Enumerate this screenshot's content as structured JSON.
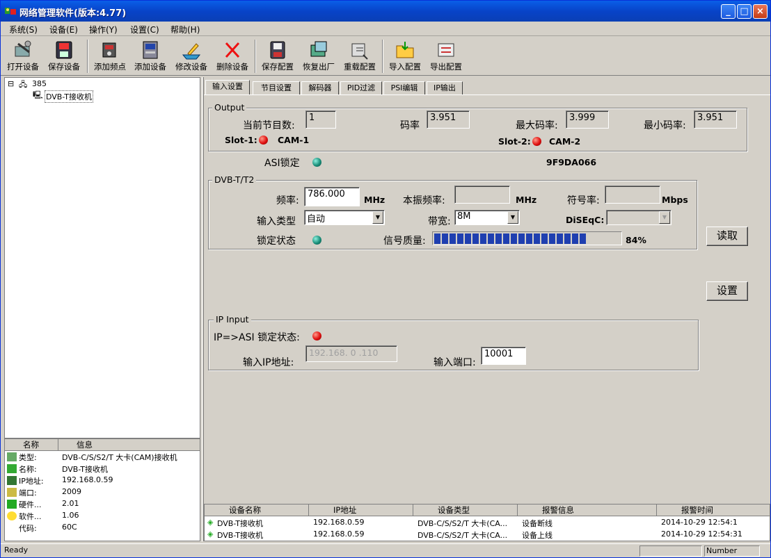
{
  "window": {
    "title": "网络管理软件(版本:4.77)"
  },
  "menu": [
    "系统(S)",
    "设备(E)",
    "操作(Y)",
    "设置(C)",
    "帮助(H)"
  ],
  "toolbar": [
    "打开设备",
    "保存设备",
    "添加频点",
    "添加设备",
    "修改设备",
    "删除设备",
    "保存配置",
    "恢复出厂",
    "重载配置",
    "导入配置",
    "导出配置"
  ],
  "tree": {
    "root": "385",
    "child": "DVB-T接收机"
  },
  "info": {
    "headers": [
      "名称",
      "信息"
    ],
    "rows": [
      {
        "k": "类型:",
        "v": "DVB-C/S/S2/T 大卡(CAM)接收机"
      },
      {
        "k": "名称:",
        "v": "DVB-T接收机"
      },
      {
        "k": "IP地址:",
        "v": "192.168.0.59"
      },
      {
        "k": "端口:",
        "v": "2009"
      },
      {
        "k": "硬件...",
        "v": "2.01"
      },
      {
        "k": "软件...",
        "v": "1.06"
      },
      {
        "k": "代码:",
        "v": "60C"
      }
    ]
  },
  "tabs": [
    "输入设置",
    "节目设置",
    "解码器",
    "PID过滤",
    "PSI编辑",
    "IP输出"
  ],
  "output": {
    "title": "Output",
    "prog_label": "当前节目数:",
    "prog_value": "1",
    "rate_label": "码率",
    "rate_value": "3.951",
    "max_label": "最大码率:",
    "max_value": "3.999",
    "min_label": "最小码率:",
    "min_value": "3.951",
    "slot1_label": "Slot-1:",
    "slot1_cam": "CAM-1",
    "slot2_label": "Slot-2:",
    "slot2_cam": "CAM-2"
  },
  "asi": {
    "label": "ASI锁定",
    "code": "9F9DA066"
  },
  "dvbt": {
    "title": "DVB-T/T2",
    "freq_label": "频率:",
    "freq_value": "786.000",
    "freq_unit": "MHz",
    "lo_label": "本振频率:",
    "lo_value": "",
    "lo_unit": "MHz",
    "sym_label": "符号率:",
    "sym_value": "",
    "sym_unit": "Mbps",
    "type_label": "输入类型",
    "type_value": "自动",
    "bw_label": "带宽:",
    "bw_value": "8M",
    "diseqc_label": "DiSEqC:",
    "diseqc_value": "",
    "lock_label": "锁定状态",
    "quality_label": "信号质量:",
    "quality_percent": 84,
    "quality_text": "84%"
  },
  "buttons": {
    "read": "读取",
    "set": "设置"
  },
  "ip_input": {
    "title": "IP Input",
    "lock_label": "IP=>ASI 锁定状态:",
    "ip_label": "输入IP地址:",
    "ip_value": "192.168. 0 .110",
    "port_label": "输入端口:",
    "port_value": "10001"
  },
  "alarms": {
    "headers": [
      "设备名称",
      "IP地址",
      "设备类型",
      "报警信息",
      "报警时间"
    ],
    "rows": [
      [
        "DVB-T接收机",
        "192.168.0.59",
        "DVB-C/S/S2/T 大卡(CA...",
        "设备断线",
        "2014-10-29 12:54:1"
      ],
      [
        "DVB-T接收机",
        "192.168.0.59",
        "DVB-C/S/S2/T 大卡(CA...",
        "设备上线",
        "2014-10-29 12:54:31"
      ]
    ]
  },
  "status": {
    "left": "Ready",
    "num": "Number"
  }
}
